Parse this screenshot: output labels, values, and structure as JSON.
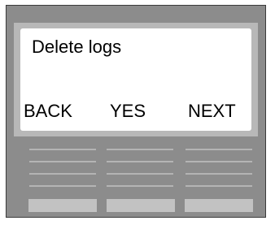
{
  "screen": {
    "title": "Delete logs",
    "softkeys": {
      "back": "BACK",
      "yes": "YES",
      "next": "NEXT"
    }
  },
  "colors": {
    "device_body": "#8c8c8c",
    "bezel": "#b8b8b8",
    "screen": "#ffffff",
    "text": "#000000",
    "keys": "#c2c2c2"
  }
}
